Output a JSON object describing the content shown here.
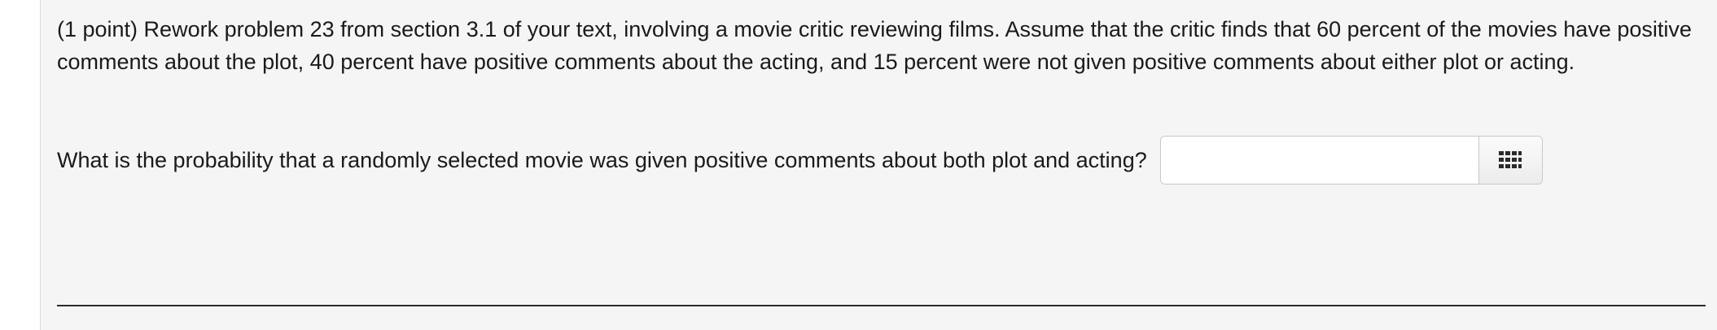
{
  "problem": {
    "statement": "(1 point) Rework problem 23 from section 3.1 of your text, involving a movie critic reviewing films. Assume that the critic finds that 60 percent of the movies have positive comments about the plot, 40 percent have positive comments about the acting, and 15 percent were not given positive comments about either plot or acting.",
    "question": "What is the probability that a randomly selected movie was given positive comments about both plot and acting?",
    "answer_value": "",
    "palette_icon": "grid-keypad-icon"
  },
  "colors": {
    "panel_background": "#f5f5f5",
    "text": "#1a1a1a",
    "divider": "#2b2b2b"
  }
}
